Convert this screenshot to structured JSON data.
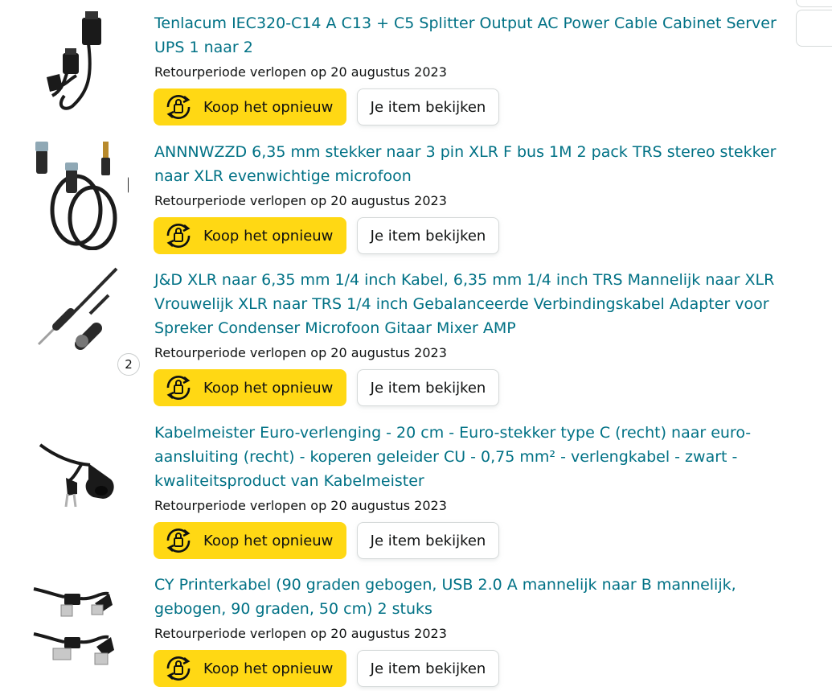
{
  "items": [
    {
      "title": "Tenlacum IEC320-C14 A C13 + C5 Splitter Output AC Power Cable Cabinet Server UPS 1 naar 2",
      "return_text": "Retourperiode verlopen op 20 augustus 2023",
      "buy_again_label": "Koop het opnieuw",
      "view_item_label": "Je item bekijken",
      "image_icon": "power-splitter-cable-icon"
    },
    {
      "title": "ANNNWZZD 6,35 mm stekker naar 3 pin XLR F bus 1M 2 pack TRS stereo stekker naar XLR evenwichtige microfoon",
      "return_text": "Retourperiode verlopen op 20 augustus 2023",
      "buy_again_label": "Koop het opnieuw",
      "view_item_label": "Je item bekijken",
      "image_icon": "xlr-trs-cable-pair-icon"
    },
    {
      "title": "J&D XLR naar 6,35 mm 1/4 inch Kabel, 6,35 mm 1/4 inch TRS Mannelijk naar XLR Vrouwelijk XLR naar TRS 1/4 inch Gebalanceerde Verbindingskabel Adapter voor Spreker Condenser Microfoon Gitaar Mixer AMP",
      "return_text": "Retourperiode verlopen op 20 augustus 2023",
      "buy_again_label": "Koop het opnieuw",
      "view_item_label": "Je item bekijken",
      "quantity": "2",
      "image_icon": "xlr-trs-cable-icon"
    },
    {
      "title": "Kabelmeister Euro-verlenging - 20 cm - Euro-stekker type C (recht) naar euro-aansluiting (recht) - koperen geleider CU - 0,75 mm² - verlengkabel - zwart - kwaliteitsproduct van Kabelmeister",
      "return_text": "Retourperiode verlopen op 20 augustus 2023",
      "buy_again_label": "Koop het opnieuw",
      "view_item_label": "Je item bekijken",
      "image_icon": "euro-extension-cable-icon"
    },
    {
      "title": "CY Printerkabel (90 graden gebogen, USB 2.0 A mannelijk naar B mannelijk, gebogen, 90 graden, 50 cm) 2 stuks",
      "return_text": "Retourperiode verlopen op 20 augustus 2023",
      "buy_again_label": "Koop het opnieuw",
      "view_item_label": "Je item bekijken",
      "image_icon": "usb-printer-cable-icon"
    }
  ],
  "colors": {
    "link": "#007185",
    "buy_button": "#ffd814",
    "text": "#0f1111",
    "border": "#d5d9d9"
  }
}
